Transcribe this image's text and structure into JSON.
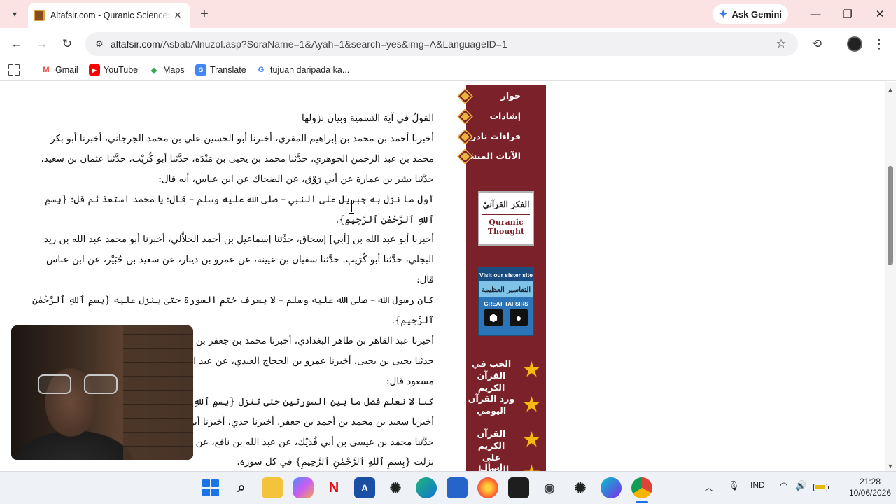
{
  "browser": {
    "tab": {
      "title": "Altafsir.com - Quranic Sciences - Asbab Al-Nuzul"
    },
    "gemini_label": "Ask Gemini",
    "url": {
      "host": "altafsir.com",
      "path": "/AsbabAlnuzol.asp?SoraName=1&Ayah=1&search=yes&img=A&LanguageID=1"
    },
    "bookmarks": [
      {
        "label": "Gmail",
        "icon": "gmail-icon",
        "color": "#ea4335"
      },
      {
        "label": "YouTube",
        "icon": "youtube-icon",
        "color": "#ff0000"
      },
      {
        "label": "Maps",
        "icon": "maps-icon",
        "color": "#34a853"
      },
      {
        "label": "Translate",
        "icon": "translate-icon",
        "color": "#4285f4"
      },
      {
        "label": "tujuan daripada ka...",
        "icon": "google-icon",
        "color": "#4285f4"
      }
    ]
  },
  "article": {
    "paragraphs": [
      "القولُ في آية التسمية وبيان نزولها",
      "أخبرنا أحمد بن محمد بن إبراهيم المقري، أخبرنا أبو الحسين علي بن محمد الجرجاني، أخبرنا أبو بكر محمد بن عبد الرحمن الجوهري، حدَّثنا محمد بن يحيى بن مَنْدَه، حدَّثنا أبو كُرَيْب، حدَّثنا عثمان بن سعيد، حدَّثنا بشر بن عمارة عن أبي رَوْق، عن الضحاك عن ابن عباس، أنه قال:",
      "أول ما نزل به جبريل على النبي – صلى الله عليه وسلم – قال: يا محمد استعذ ثم قل: {بِسمِ ٱللهِ ٱلرَّحْمٰنِ ٱلرَّحِيمِ}.",
      "أخبرنا أبو عبد الله بن [أبي] إسحاق، حدَّثنا إسماعيل بن أحمد الخلاَّلي، أخبرنا أبو محمد عبد الله بن زيد البجلي، حدَّثنا أبو كُرَيب. حدَّثنا سفيان بن عيينة، عن عمرو بن دينار، عن سعيد بن جُبَيْر، عن ابن عباس قال:",
      "كان رسول الله – صلى الله عليه وسلم – لا يعرف ختم السورة حتى ينزل عليه {بِسمِ ٱللهِ ٱلرَّحْمٰنِ ٱلرَّحِيمِ}.",
      "أخبرنا عبد القاهر بن طاهر البغدادي، أخبرنا محمد بن جعفر بن مطر، أخبرنا إبراهيم بن علي الذُّهلي، حدثنا يحيى بن يحيى، أخبرنا عمرو بن الحجاج العبدي، عن عبد الله بن أبي حسين، عن عبد الله بن مسعود قال:",
      "كنا لا نعلم فصل ما بين السورتين حتى تنزل {بِسمِ ٱللهِ ٱلرَّحْمٰنِ ٱلرَّحِيمِ}.",
      "أخبرنا سعيد بن محمد بن أحمد بن جعفر، أخبرنا جدي، أخبرنا أبو عمرو الحيري، حدَّثنا محمد بن يحيى، حدَّثنا محمد بن عيسى بن أبي فُدَيْك، عن عبد الله بن نافع، عن أبيه، عن ابن عمر، قال:",
      "نزلت {بِسمِ ٱللهِ ٱلرَّحْمٰنِ ٱلرَّحِيمِ} في كل سورة."
    ]
  },
  "sidebar": {
    "links": [
      "حوار",
      "إشادات",
      "قراءات نادرة",
      "الآيات المتشابهات"
    ],
    "quranic_thought": {
      "ar": "الفكر القرآنيّ",
      "en_line1": "Quranic",
      "en_line2": "Thought"
    },
    "great_tafsirs": {
      "top": "Visit our sister site",
      "ar": "التفاسير العظيمة",
      "en": "GREAT TAFSIRS"
    },
    "star_links": [
      {
        "line1": "الحب في",
        "line2": "القرآن الكريم"
      },
      {
        "line1": "ورد القرآن",
        "line2": "اليومي"
      },
      {
        "line1": "القرآن الكريم",
        "line2": "على الموبايل"
      },
      {
        "line1": "اسأل المفتي",
        "line2": ""
      }
    ]
  },
  "taskbar": {
    "language": "IND",
    "time": "21:28",
    "date": "10/06/2026",
    "apps": [
      {
        "name": "start-icon"
      },
      {
        "name": "search-icon"
      },
      {
        "name": "file-explorer-icon"
      },
      {
        "name": "copilot-icon"
      },
      {
        "name": "netflix-icon"
      },
      {
        "name": "autocad-icon"
      },
      {
        "name": "chatgpt-icon"
      },
      {
        "name": "edge-icon"
      },
      {
        "name": "store-icon"
      },
      {
        "name": "firefox-icon"
      },
      {
        "name": "figma-icon"
      },
      {
        "name": "camera-icon"
      },
      {
        "name": "chatgpt-app-icon"
      },
      {
        "name": "canva-icon"
      },
      {
        "name": "chrome-icon"
      }
    ]
  },
  "colors": {
    "tabstrip": "#fbe3e3",
    "sidebar": "#7b2129",
    "accent_gold": "#e9b43e",
    "star": "#f4b912"
  }
}
